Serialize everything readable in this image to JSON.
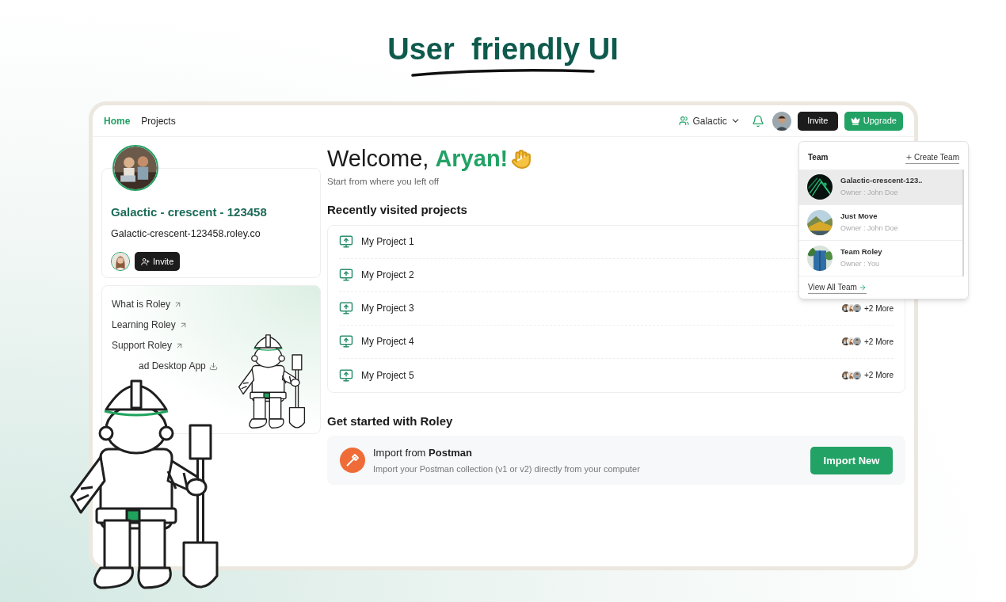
{
  "headline": "User  friendly UI",
  "nav": {
    "tabs": [
      {
        "label": "Home",
        "selected": true
      },
      {
        "label": "Projects",
        "selected": false
      }
    ],
    "workspace": "Galactic",
    "invite": "Invite",
    "upgrade": "Upgrade"
  },
  "workspace_card": {
    "name": "Galactic - crescent - 123458",
    "url": "Galactic-crescent-123458.roley.co",
    "invite": "Invite"
  },
  "links": [
    {
      "label": "What is Roley",
      "kind": "external"
    },
    {
      "label": "Learning Roley",
      "kind": "external"
    },
    {
      "label": "Support Roley",
      "kind": "external"
    },
    {
      "label": "ad Desktop App",
      "kind": "download"
    }
  ],
  "welcome": {
    "greeting": "Welcome,",
    "name": "Aryan!",
    "subtitle": "Start from where you left off"
  },
  "projects_heading": "Recently visited projects",
  "projects": [
    {
      "name": "My Project 1"
    },
    {
      "name": "My Project 2"
    },
    {
      "name": "My Project 3",
      "members": "+2 More"
    },
    {
      "name": "My Project 4",
      "members": "+2 More"
    },
    {
      "name": "My Project 5",
      "members": "+2 More"
    }
  ],
  "get_started": {
    "heading": "Get started with Roley",
    "title": "Import from **Postman**",
    "description": "Import your Postman collection (v1 or v2) directly from your computer",
    "button": "Import New"
  },
  "team_menu": {
    "title": "Team",
    "create": "Create Team",
    "teams": [
      {
        "name": "Galactic-crescent-123..",
        "owner": "Owner : John Doe",
        "selected": true
      },
      {
        "name": "Just Move",
        "owner": "Owner : John Doe",
        "selected": false
      },
      {
        "name": "Team Roley",
        "owner": "Owner : You",
        "selected": false
      }
    ],
    "view_all": "View All Team"
  }
}
